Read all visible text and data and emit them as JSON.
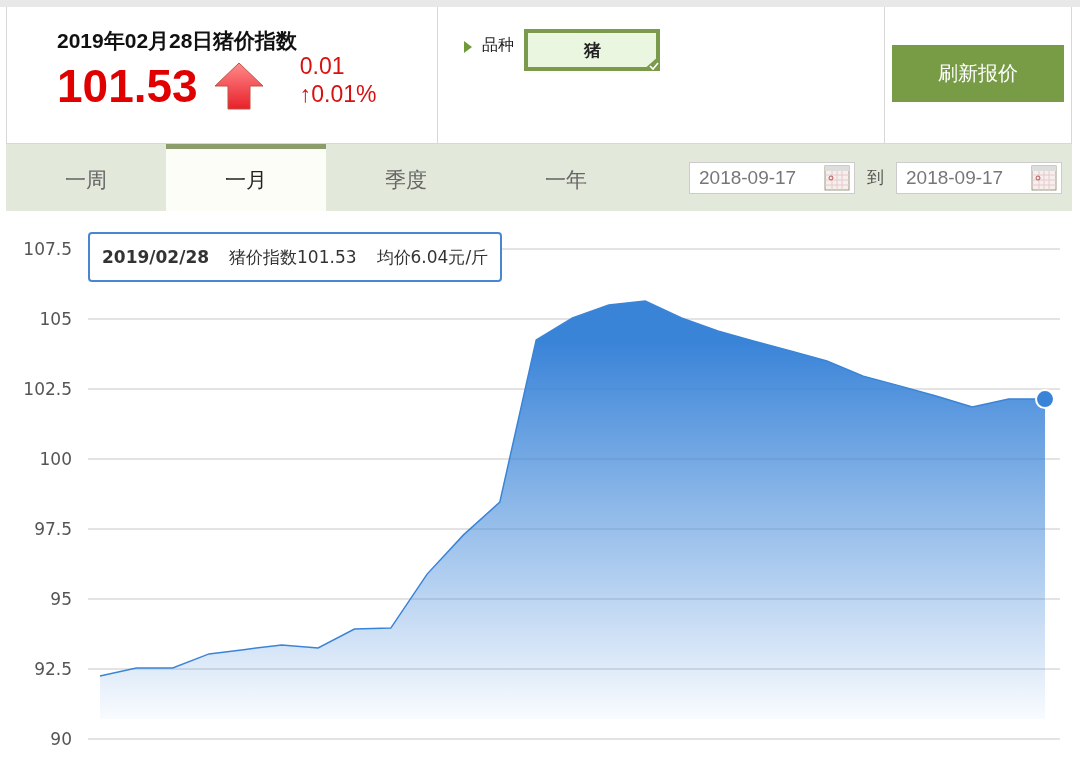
{
  "header": {
    "title": "2019年02月28日猪价指数",
    "index_value": "101.53",
    "arrow": {
      "kind": "up"
    },
    "change": "0.01",
    "change_percent": "↑0.01%"
  },
  "variety": {
    "label": "品种",
    "value": "猪",
    "checked": true
  },
  "refresh_button": "刷新报价",
  "tabs": [
    {
      "label": "一周",
      "selected": false
    },
    {
      "label": "一月",
      "selected": true
    },
    {
      "label": "季度",
      "selected": false
    },
    {
      "label": "一年",
      "selected": false
    }
  ],
  "date_range": {
    "start": "2018-09-17",
    "separator": "到",
    "end": "2018-09-17"
  },
  "tooltip": {
    "date": "2019/02/28",
    "index": "猪价指数101.53",
    "price": "均价6.04元/斤"
  },
  "chart_data": {
    "type": "area",
    "grid": true,
    "ylim": [
      90,
      107.5
    ],
    "yticks": [
      90,
      92.5,
      95,
      97.5,
      100,
      102.5,
      105,
      107.5
    ],
    "series": [
      {
        "color": "#3a84d8",
        "values": [
          92.25,
          92.54,
          92.54,
          93.04,
          93.2,
          93.36,
          93.25,
          93.93,
          93.96,
          95.89,
          97.29,
          98.46,
          104.25,
          105.04,
          105.5,
          105.64,
          105.04,
          104.57,
          104.21,
          103.86,
          103.5,
          102.96,
          102.61,
          102.25,
          101.86,
          102.14,
          102.14
        ]
      }
    ]
  }
}
